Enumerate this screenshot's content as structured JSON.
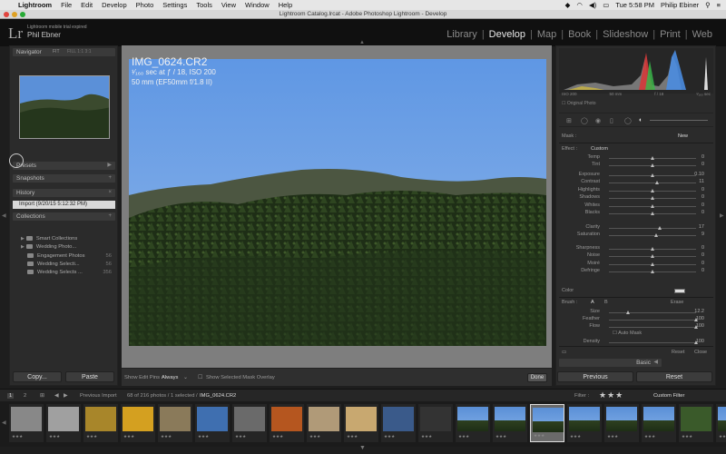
{
  "menubar": {
    "apple": "",
    "items": [
      "Lightroom",
      "File",
      "Edit",
      "Develop",
      "Photo",
      "Settings",
      "Tools",
      "View",
      "Window",
      "Help"
    ],
    "clock": "Tue 5:58 PM",
    "user": "Philip Ebiner"
  },
  "window": {
    "title": "Lightroom Catalog.lrcat - Adobe Photoshop Lightroom - Develop"
  },
  "identity": {
    "logo": "Lr",
    "mobile_message": "Lightroom mobile trial expired",
    "user_name": "Phil Ebner"
  },
  "modules": [
    "Library",
    "Develop",
    "Map",
    "Book",
    "Slideshow",
    "Print",
    "Web"
  ],
  "active_module": "Develop",
  "left_panel": {
    "navigator": {
      "title": "Navigator",
      "zoom": "FIT",
      "zoom_options": "FILL 1:1 3:1"
    },
    "presets": "Presets",
    "snapshots": "Snapshots",
    "history": "History",
    "history_items": [
      "Import (9/20/15 5:12:32 PM)"
    ],
    "collections": "Collections",
    "collection_items": [
      {
        "name": "Smart Collections",
        "count": ""
      },
      {
        "name": "Wedding Photo...",
        "count": ""
      },
      {
        "name": "Engagement Photos",
        "count": "56"
      },
      {
        "name": "Wedding Selecti...",
        "count": "56"
      },
      {
        "name": "Wedding Selects ...",
        "count": "356"
      }
    ],
    "copy_label": "Copy...",
    "paste_label": "Paste"
  },
  "photo": {
    "name": "IMG_0624.CR2",
    "exif": "¹⁄₁₆₀ sec at ƒ / 18, ISO 200",
    "lens": "50 mm (EF50mm f/1.8 II)"
  },
  "toolbar": {
    "show_edit_pins_label": "Show Edit Pins :",
    "show_edit_pins_value": "Always",
    "overlay_label": "Show Selected Mask Overlay",
    "done_label": "Done"
  },
  "right_panel": {
    "histogram_info": [
      "ISO 200",
      "50 mm",
      "f / 18",
      "¹⁄₁₆₀ sec"
    ],
    "original_photo": "Original Photo",
    "mask_label": "Mask :",
    "mask_new": "New",
    "effect_label": "Effect :",
    "effect_value": "Custom",
    "sliders": [
      {
        "label": "Temp",
        "value": "0",
        "pos": 0.5
      },
      {
        "label": "Tint",
        "value": "0",
        "pos": 0.5
      },
      {
        "label": "Exposure",
        "value": "0.10",
        "pos": 0.51
      },
      {
        "label": "Contrast",
        "value": "11",
        "pos": 0.56
      },
      {
        "label": "Highlights",
        "value": "0",
        "pos": 0.5
      },
      {
        "label": "Shadows",
        "value": "0",
        "pos": 0.5
      },
      {
        "label": "Whites",
        "value": "0",
        "pos": 0.5
      },
      {
        "label": "Blacks",
        "value": "0",
        "pos": 0.5
      },
      {
        "label": "Clarity",
        "value": "17",
        "pos": 0.59
      },
      {
        "label": "Saturation",
        "value": "9",
        "pos": 0.55
      },
      {
        "label": "Sharpness",
        "value": "0",
        "pos": 0.5
      },
      {
        "label": "Noise",
        "value": "0",
        "pos": 0.5
      },
      {
        "label": "Moiré",
        "value": "0",
        "pos": 0.5
      },
      {
        "label": "Defringe",
        "value": "0",
        "pos": 0.5
      }
    ],
    "color_label": "Color",
    "brush_label": "Brush :",
    "brush_a": "A",
    "brush_b": "B",
    "brush_erase": "Erase",
    "brush_sliders": [
      {
        "label": "Size",
        "value": "12.2",
        "pos": 0.22
      },
      {
        "label": "Feather",
        "value": "100",
        "pos": 1.0
      },
      {
        "label": "Flow",
        "value": "100",
        "pos": 1.0
      },
      {
        "label": "Density",
        "value": "100",
        "pos": 1.0
      }
    ],
    "auto_mask": "Auto Mask",
    "reset_label": "Reset",
    "close_label": "Close",
    "basic_label": "Basic",
    "previous_label": "Previous",
    "reset_button": "Reset"
  },
  "filmstrip": {
    "page1": "1",
    "page2": "2",
    "source": "Previous Import",
    "count": "68 of 216 photos / 1 selected /",
    "current_file": "IMG_0624.CR2",
    "filter_label": "Filter :",
    "stars": "★★★",
    "custom_filter": "Custom Filter",
    "cell_stars": "★★★"
  },
  "colors": {
    "accent": "#e8e8e8",
    "panel": "#2b2b2b",
    "center_bg": "#7e7e7e"
  }
}
